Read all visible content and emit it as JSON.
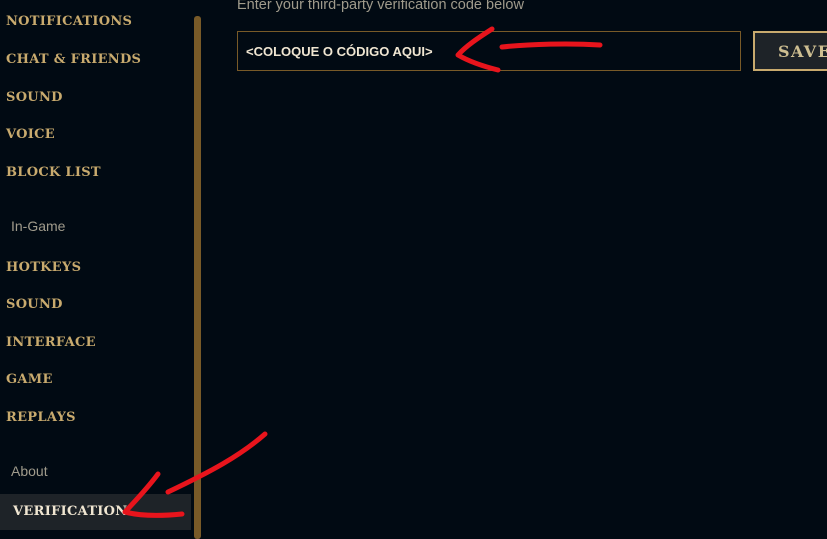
{
  "sidebar": {
    "items": [
      {
        "label": "NOTIFICATIONS"
      },
      {
        "label": "CHAT & FRIENDS"
      },
      {
        "label": "SOUND"
      },
      {
        "label": "VOICE"
      },
      {
        "label": "BLOCK LIST"
      }
    ],
    "sections": [
      {
        "label": "In-Game"
      },
      {
        "label": "About"
      }
    ],
    "ingame_items": [
      {
        "label": "HOTKEYS"
      },
      {
        "label": "SOUND"
      },
      {
        "label": "INTERFACE"
      },
      {
        "label": "GAME"
      },
      {
        "label": "REPLAYS"
      }
    ],
    "about_items": [
      {
        "label": "VERIFICATION"
      }
    ]
  },
  "main": {
    "instruction": "Enter your third-party verification code below",
    "code_value": "<COLOQUE O CÓDIGO AQUI>",
    "save_label": "SAVE"
  },
  "colors": {
    "background": "#010a13",
    "gold": "#c8aa6e",
    "annotation_red": "#e8141c"
  }
}
